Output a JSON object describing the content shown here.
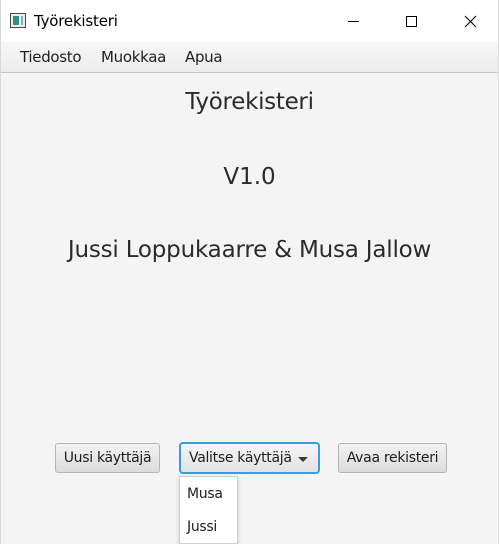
{
  "window": {
    "title": "Työrekisteri",
    "app_icon": "window-app-icon",
    "controls": [
      "minimize-icon",
      "maximize-icon",
      "close-icon"
    ]
  },
  "menu": {
    "items": [
      {
        "label": "Tiedosto"
      },
      {
        "label": "Muokkaa"
      },
      {
        "label": "Apua"
      }
    ]
  },
  "main": {
    "title": "Työrekisteri",
    "version": "V1.0",
    "authors": "Jussi Loppukaarre & Musa Jallow"
  },
  "actions": {
    "new_user_label": "Uusi käyttäjä",
    "select_user_label": "Valitse käyttäjä",
    "open_register_label": "Avaa rekisteri"
  },
  "user_dropdown": {
    "options": [
      {
        "label": "Musa"
      },
      {
        "label": "Jussi"
      }
    ]
  },
  "colors": {
    "focus_border": "#3c9bd8",
    "window_bg": "#f4f4f4"
  }
}
